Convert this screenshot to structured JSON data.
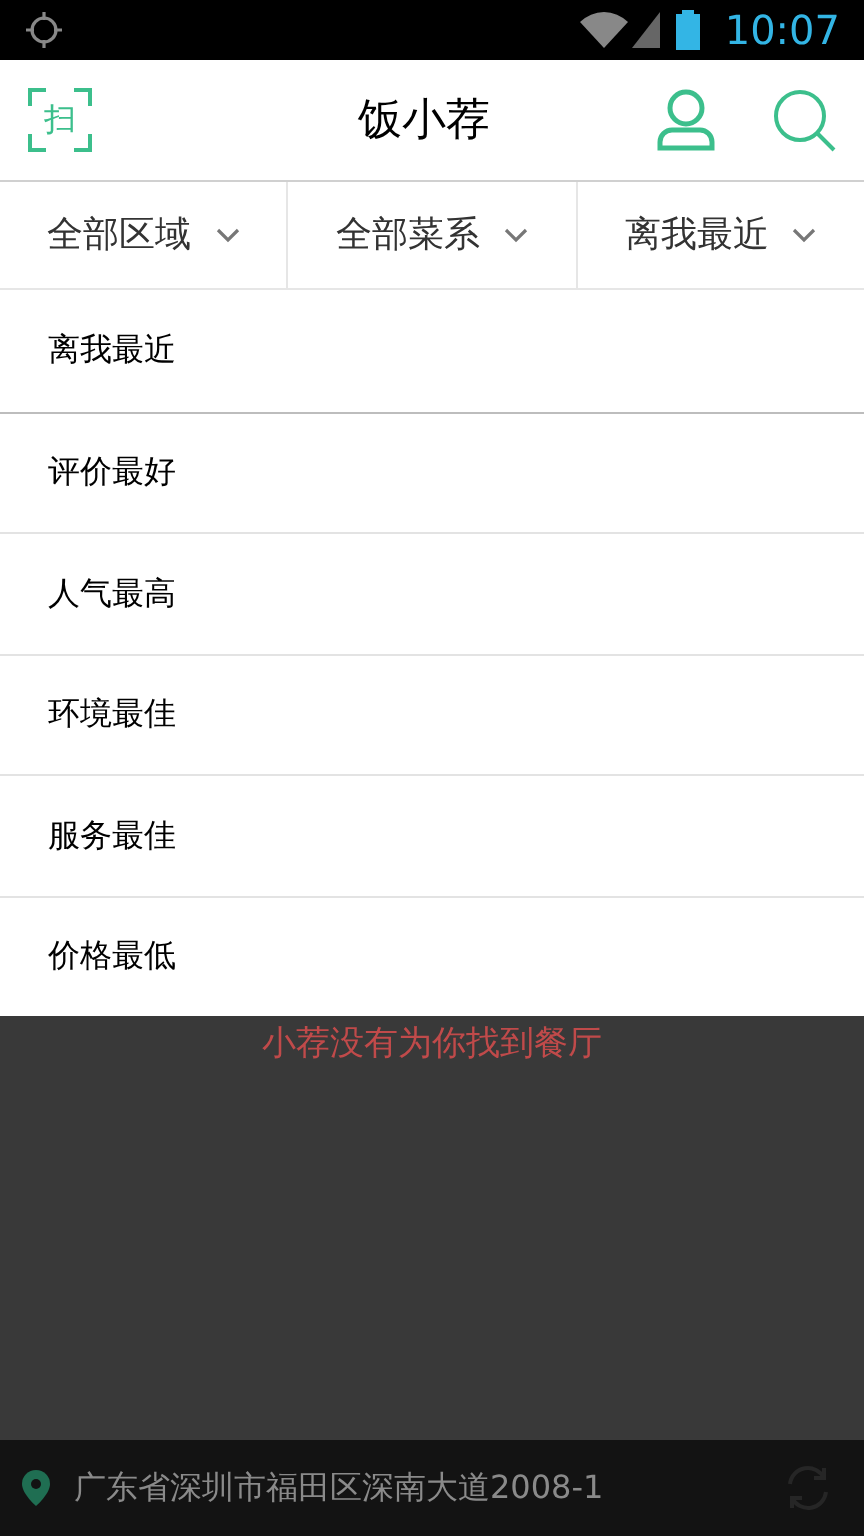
{
  "status_bar": {
    "time": "10:07"
  },
  "header": {
    "scan_label": "扫",
    "title": "饭小荐"
  },
  "filters": [
    {
      "label": "全部区域"
    },
    {
      "label": "全部菜系"
    },
    {
      "label": "离我最近"
    }
  ],
  "sort_menu": [
    "离我最近",
    "评价最好",
    "人气最高",
    "环境最佳",
    "服务最佳",
    "价格最低"
  ],
  "empty_message": "小荐没有为你找到餐厅",
  "location_bar": {
    "address": "广东省深圳市福田区深南大道2008-1"
  }
}
